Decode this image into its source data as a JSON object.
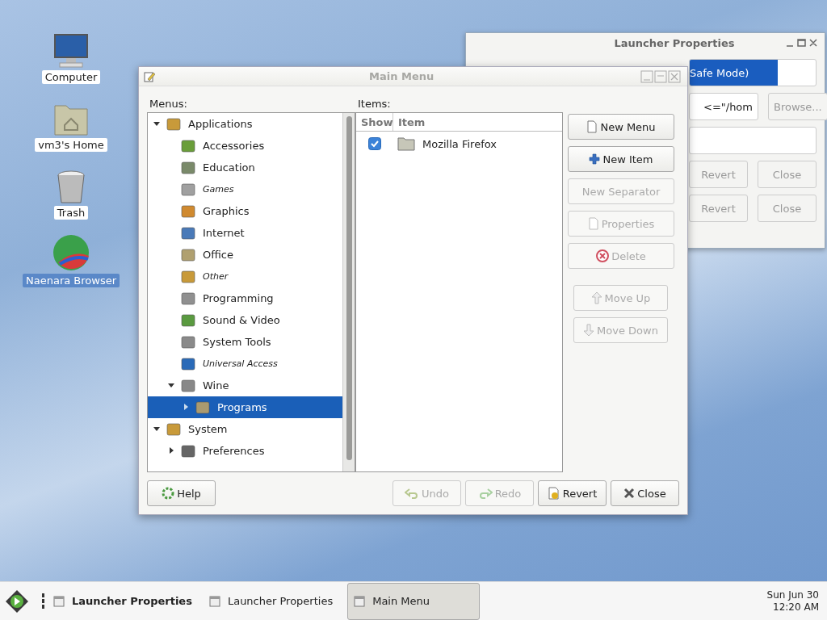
{
  "desktop_icons": [
    {
      "label": "Computer",
      "kind": "computer",
      "selected": false
    },
    {
      "label": "vm3's Home",
      "kind": "home",
      "selected": false
    },
    {
      "label": "Trash",
      "kind": "trash",
      "selected": false
    },
    {
      "label": "Naenara Browser",
      "kind": "globe",
      "selected": true
    }
  ],
  "launcher_window": {
    "title": "Launcher Properties",
    "name_field": "Safe Mode)",
    "command_field": "<=\"/hom",
    "browse_button": "Browse...",
    "buttons": [
      {
        "label": "Revert"
      },
      {
        "label": "Close"
      }
    ],
    "back_buttons": [
      {
        "label": "Revert"
      },
      {
        "label": "Close"
      }
    ]
  },
  "main_window": {
    "title": "Main Menu",
    "menus_label": "Menus:",
    "items_label": "Items:",
    "tree": [
      {
        "label": "Applications",
        "expanded": true,
        "hidden": false,
        "selected": false,
        "children": [
          {
            "label": "Accessories",
            "hidden": false,
            "selected": false
          },
          {
            "label": "Education",
            "hidden": false,
            "selected": false
          },
          {
            "label": "Games",
            "hidden": true,
            "selected": false
          },
          {
            "label": "Graphics",
            "hidden": false,
            "selected": false
          },
          {
            "label": "Internet",
            "hidden": false,
            "selected": false
          },
          {
            "label": "Office",
            "hidden": false,
            "selected": false
          },
          {
            "label": "Other",
            "hidden": true,
            "selected": false
          },
          {
            "label": "Programming",
            "hidden": false,
            "selected": false
          },
          {
            "label": "Sound & Video",
            "hidden": false,
            "selected": false
          },
          {
            "label": "System Tools",
            "hidden": false,
            "selected": false
          },
          {
            "label": "Universal Access",
            "hidden": true,
            "selected": false
          },
          {
            "label": "Wine",
            "expanded": true,
            "hidden": false,
            "selected": false,
            "children": [
              {
                "label": "Programs",
                "expanded": false,
                "hidden": false,
                "selected": true
              }
            ]
          }
        ]
      },
      {
        "label": "System",
        "expanded": true,
        "hidden": false,
        "selected": false,
        "children": [
          {
            "label": "Preferences",
            "expanded": false,
            "hidden": false,
            "selected": false
          }
        ]
      }
    ],
    "table": {
      "columns": [
        "Show",
        "Item"
      ],
      "rows": [
        {
          "show": true,
          "item": "Mozilla Firefox"
        }
      ]
    },
    "actions": [
      {
        "label": "New Menu",
        "kind": "new-menu",
        "disabled": false
      },
      {
        "label": "New Item",
        "kind": "new-item",
        "disabled": false
      },
      {
        "label": "New Separator",
        "kind": "plain",
        "disabled": true
      },
      {
        "label": "Properties",
        "kind": "properties",
        "disabled": true
      },
      {
        "label": "Delete",
        "kind": "delete",
        "disabled": true
      }
    ],
    "move_actions": [
      {
        "label": "Move Up",
        "kind": "up",
        "disabled": true
      },
      {
        "label": "Move Down",
        "kind": "down",
        "disabled": true
      }
    ],
    "help_button": {
      "label": "Help",
      "disabled": false
    },
    "footer_buttons": [
      {
        "label": "Undo",
        "kind": "undo",
        "disabled": true
      },
      {
        "label": "Redo",
        "kind": "redo",
        "disabled": true
      },
      {
        "label": "Revert",
        "kind": "revert",
        "disabled": false
      },
      {
        "label": "Close",
        "kind": "close",
        "disabled": false
      }
    ]
  },
  "taskbar": {
    "items": [
      {
        "label": "Launcher Properties",
        "attention": true,
        "selected": false
      },
      {
        "label": "Launcher Properties",
        "attention": false,
        "selected": false
      },
      {
        "label": "Main Menu",
        "attention": false,
        "selected": true
      }
    ],
    "date": "Sun Jun 30",
    "time": "12:20 AM"
  }
}
